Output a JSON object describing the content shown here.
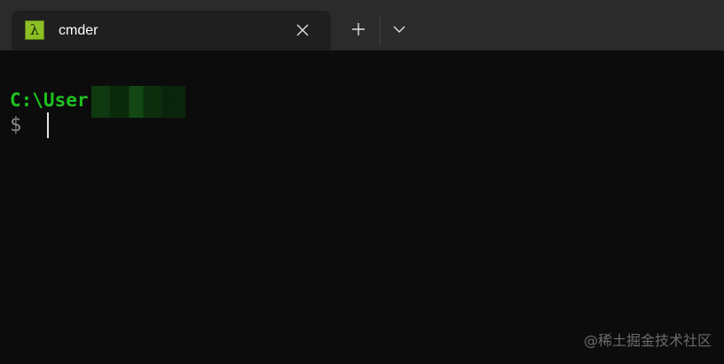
{
  "tab": {
    "title": "cmder",
    "icon": "lambda-icon",
    "icon_glyph": "λ",
    "close_icon": "close-icon"
  },
  "titlebar": {
    "new_tab_icon": "plus-icon",
    "dropdown_icon": "chevron-down-icon"
  },
  "terminal": {
    "path_text": "C:\\User",
    "prompt_symbol": "$",
    "path_color": "#1fc21f",
    "prompt_color": "#8a8a8a"
  },
  "watermark": "@稀土掘金技术社区"
}
